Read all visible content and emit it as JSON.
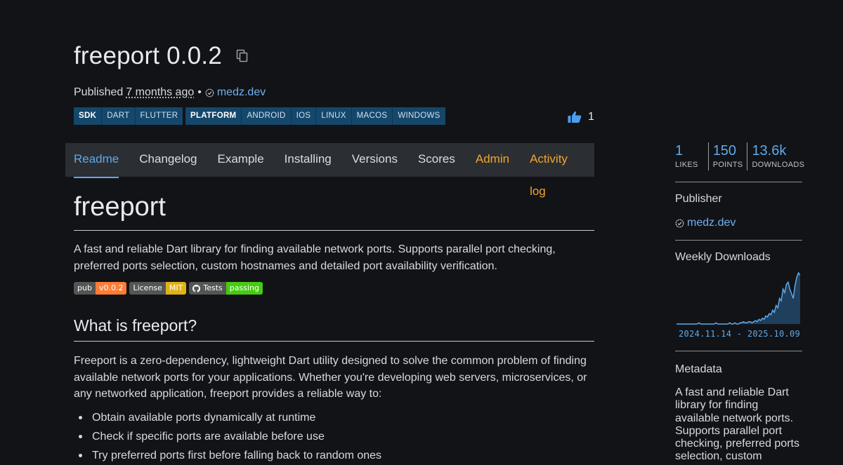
{
  "package": {
    "title": "freeport 0.0.2",
    "published_label": "Published",
    "published_ago": "7 months ago",
    "separator": "•",
    "publisher": "medz.dev"
  },
  "tags": {
    "sdk": [
      "SDK",
      "DART",
      "FLUTTER"
    ],
    "platform": [
      "PLATFORM",
      "ANDROID",
      "IOS",
      "LINUX",
      "MACOS",
      "WINDOWS"
    ]
  },
  "likes": {
    "count": "1"
  },
  "tabs": [
    "Readme",
    "Changelog",
    "Example",
    "Installing",
    "Versions",
    "Scores",
    "Admin",
    "Activity log"
  ],
  "readme": {
    "h1": "freeport",
    "intro_line1": "A fast and reliable Dart library for finding available network ports. Supports parallel port checking,",
    "intro_line2": "preferred ports selection, custom hostnames and detailed port availability verification.",
    "badges": [
      {
        "label": "pub",
        "value": "v0.0.2",
        "color": "#fe7d37"
      },
      {
        "label": "License",
        "value": "MIT",
        "color": "#dfb317"
      },
      {
        "label": "Tests",
        "value": "passing",
        "color": "#44cc11"
      }
    ],
    "h2": "What is freeport?",
    "body_line1": "Freeport is a zero-dependency, lightweight Dart utility designed to solve the common problem of finding",
    "body_line2": "available network ports for your applications. Whether you're developing web servers, microservices, or",
    "body_line3": "any networked application, freeport provides a reliable way to:",
    "bullets": [
      "Obtain available ports dynamically at runtime",
      "Check if specific ports are available before use",
      "Try preferred ports first before falling back to random ones"
    ]
  },
  "sidebar": {
    "stats": [
      {
        "value": "1",
        "label": "LIKES"
      },
      {
        "value": "150",
        "label": "POINTS"
      },
      {
        "value": "13.6k",
        "label": "DOWNLOADS"
      }
    ],
    "publisher_heading": "Publisher",
    "publisher": "medz.dev",
    "weekly_heading": "Weekly Downloads",
    "weekly_range": "2024.11.14 - 2025.10.09",
    "weekly_series": [
      0,
      0,
      0,
      0,
      0,
      0,
      0,
      0,
      0,
      0,
      0,
      0,
      0,
      1,
      0,
      0,
      0,
      0,
      0,
      0,
      0,
      0,
      0,
      1,
      0,
      0,
      0,
      0,
      0,
      0,
      0,
      1,
      0,
      0,
      1,
      0,
      0,
      1,
      1,
      2,
      1,
      1,
      2,
      2,
      1,
      2,
      3,
      2,
      4,
      3,
      5,
      4,
      7,
      6,
      9,
      8,
      12,
      10,
      16,
      14,
      22,
      20,
      30,
      27,
      34,
      36,
      30,
      26,
      22,
      33,
      40,
      44,
      42
    ],
    "metadata_heading": "Metadata",
    "metadata_lines": [
      "A fast and reliable Dart",
      "library for finding",
      "available network ports.",
      "Supports parallel port",
      "checking, preferred ports",
      "selection, custom"
    ]
  },
  "colors": {
    "accent": "#5ea9ec",
    "admin": "#f2a531",
    "tag_bg": "#15476b",
    "tab_bg": "#2b2e33"
  }
}
